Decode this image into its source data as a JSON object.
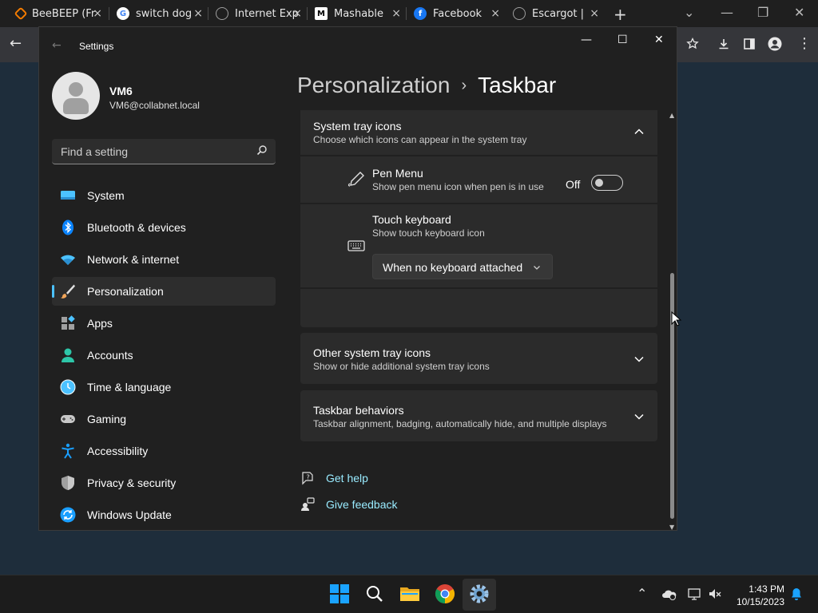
{
  "browser": {
    "tabs": [
      {
        "title": "BeeBEEP (Fr",
        "icon": "beebeep-icon",
        "icon_color": "#f57c00"
      },
      {
        "title": "switch dog",
        "icon": "google-icon",
        "icon_color": "#ffffff"
      },
      {
        "title": "Internet Exp",
        "icon": "globe-icon",
        "icon_color": "#9e9e9e"
      },
      {
        "title": "Mashable",
        "icon": "mashable-icon",
        "icon_color": "#ffffff"
      },
      {
        "title": "Facebook",
        "icon": "facebook-icon",
        "icon_color": "#1877f2"
      },
      {
        "title": "Escargot | I",
        "icon": "globe-icon",
        "icon_color": "#9e9e9e"
      }
    ],
    "new_tab_label": "+",
    "close_glyph": "×"
  },
  "window": {
    "title": "Settings"
  },
  "profile": {
    "name": "VM6",
    "email": "VM6@collabnet.local"
  },
  "search": {
    "placeholder": "Find a setting"
  },
  "nav": {
    "items": [
      {
        "label": "System",
        "icon": "system-icon"
      },
      {
        "label": "Bluetooth & devices",
        "icon": "bluetooth-icon"
      },
      {
        "label": "Network & internet",
        "icon": "wifi-icon"
      },
      {
        "label": "Personalization",
        "icon": "brush-icon",
        "active": true
      },
      {
        "label": "Apps",
        "icon": "apps-icon"
      },
      {
        "label": "Accounts",
        "icon": "accounts-icon"
      },
      {
        "label": "Time & language",
        "icon": "time-language-icon"
      },
      {
        "label": "Gaming",
        "icon": "gaming-icon"
      },
      {
        "label": "Accessibility",
        "icon": "accessibility-icon"
      },
      {
        "label": "Privacy & security",
        "icon": "shield-icon"
      },
      {
        "label": "Windows Update",
        "icon": "update-icon"
      }
    ]
  },
  "header": {
    "parent": "Personalization",
    "separator": "›",
    "current": "Taskbar"
  },
  "system_tray": {
    "title": "System tray icons",
    "subtitle": "Choose which icons can appear in the system tray",
    "expanded": true,
    "pen_menu": {
      "title": "Pen Menu",
      "subtitle": "Show pen menu icon when pen is in use",
      "state_label": "Off",
      "on": false
    },
    "touch_keyboard": {
      "title": "Touch keyboard",
      "subtitle": "Show touch keyboard icon",
      "selected": "When no keyboard attached"
    }
  },
  "other_tray": {
    "title": "Other system tray icons",
    "subtitle": "Show or hide additional system tray icons"
  },
  "taskbar_behaviors": {
    "title": "Taskbar behaviors",
    "subtitle": "Taskbar alignment, badging, automatically hide, and multiple displays"
  },
  "links": {
    "help": "Get help",
    "feedback": "Give feedback"
  },
  "clock": {
    "time": "1:43 PM",
    "date": "10/15/2023"
  },
  "colors": {
    "accent": "#4cc2ff",
    "link": "#99ebff",
    "window_bg": "#202020",
    "card_bg": "#2b2b2b"
  }
}
